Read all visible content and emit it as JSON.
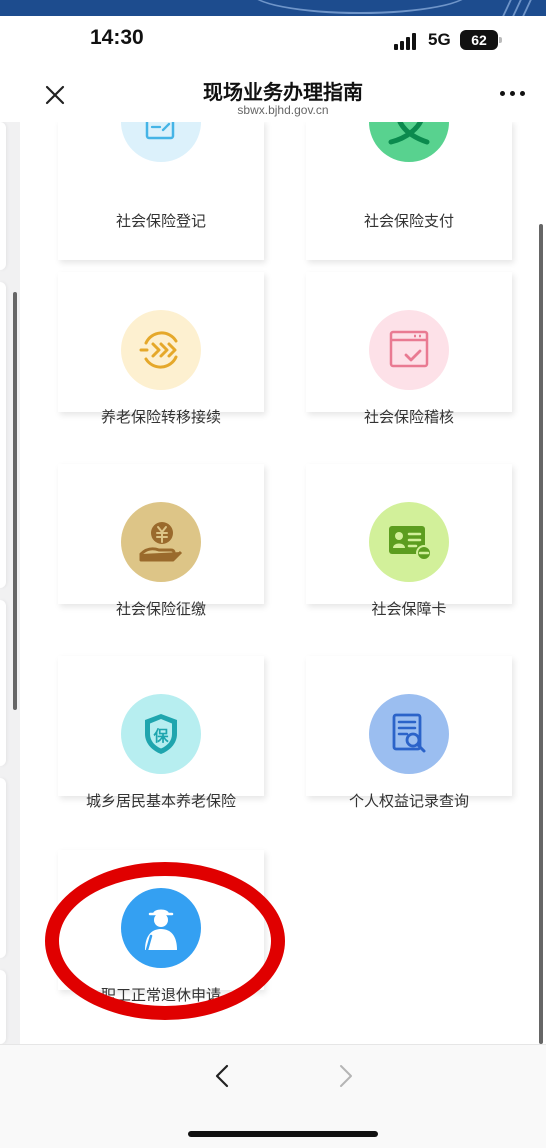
{
  "status_bar": {
    "time": "14:30",
    "network": "5G",
    "battery": "62"
  },
  "nav": {
    "title": "现场业务办理指南",
    "subtitle": "sbwx.bjhd.gov.cn"
  },
  "services": [
    {
      "label": "社会保险登记",
      "icon": "document-icon",
      "circle_color": "#dcf1fb",
      "icon_color": "#45b4e6"
    },
    {
      "label": "社会保险支付",
      "icon": "alipay-zhi-icon",
      "circle_color": "#58d28f",
      "icon_color": "#0b8a4e"
    },
    {
      "label": "养老保险转移接续",
      "icon": "transfer-arrows-icon",
      "circle_color": "#fdf0d0",
      "icon_color": "#e5a82a"
    },
    {
      "label": "社会保险稽核",
      "icon": "calendar-check-icon",
      "circle_color": "#fde1e8",
      "icon_color": "#e97a92"
    },
    {
      "label": "社会保险征缴",
      "icon": "hand-coin-icon",
      "circle_color": "#ddc587",
      "icon_color": "#9a6a2c"
    },
    {
      "label": "社会保障卡",
      "icon": "id-card-icon",
      "circle_color": "#d2f09a",
      "icon_color": "#5c9d1f"
    },
    {
      "label": "城乡居民基本养老保险",
      "icon": "shield-bao-icon",
      "circle_color": "#b7eef0",
      "icon_color": "#1fa5ae"
    },
    {
      "label": "个人权益记录查询",
      "icon": "document-search-icon",
      "circle_color": "#9bbef0",
      "icon_color": "#2b63c9"
    },
    {
      "label": "职工正常退休申请",
      "icon": "retiree-icon",
      "circle_color": "#34a0f2",
      "icon_color": "#ffffff"
    }
  ]
}
